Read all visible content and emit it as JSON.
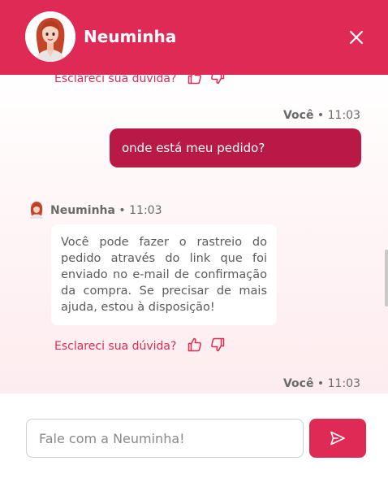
{
  "header": {
    "title": "Neuminha",
    "avatar_icon": "woman-avatar-icon",
    "close_icon": "close-icon"
  },
  "colors": {
    "brand": "#de2a55",
    "user_bubble": "#b81a45",
    "bot_text": "#5a5a5a",
    "meta_text": "#6a6a6a"
  },
  "messages": {
    "prev_feedback": "Esclareci sua dúvida?",
    "user_sender": "Você",
    "user_time": "11:03",
    "user_text": "onde está meu pedido?",
    "bot_sender": "Neuminha",
    "bot_time": "11:03",
    "bot_text": "Você pode fazer o rastreio do pedido através do link que foi enviado no e-mail de confirmação da compra. Se precisar de mais ajuda, estou à disposição!",
    "feedback_label": "Esclareci sua dúvida?",
    "next_sender": "Você",
    "next_time": "11:03"
  },
  "composer": {
    "placeholder": "Fale com a Neuminha!",
    "value": "",
    "send_icon": "send-icon"
  }
}
